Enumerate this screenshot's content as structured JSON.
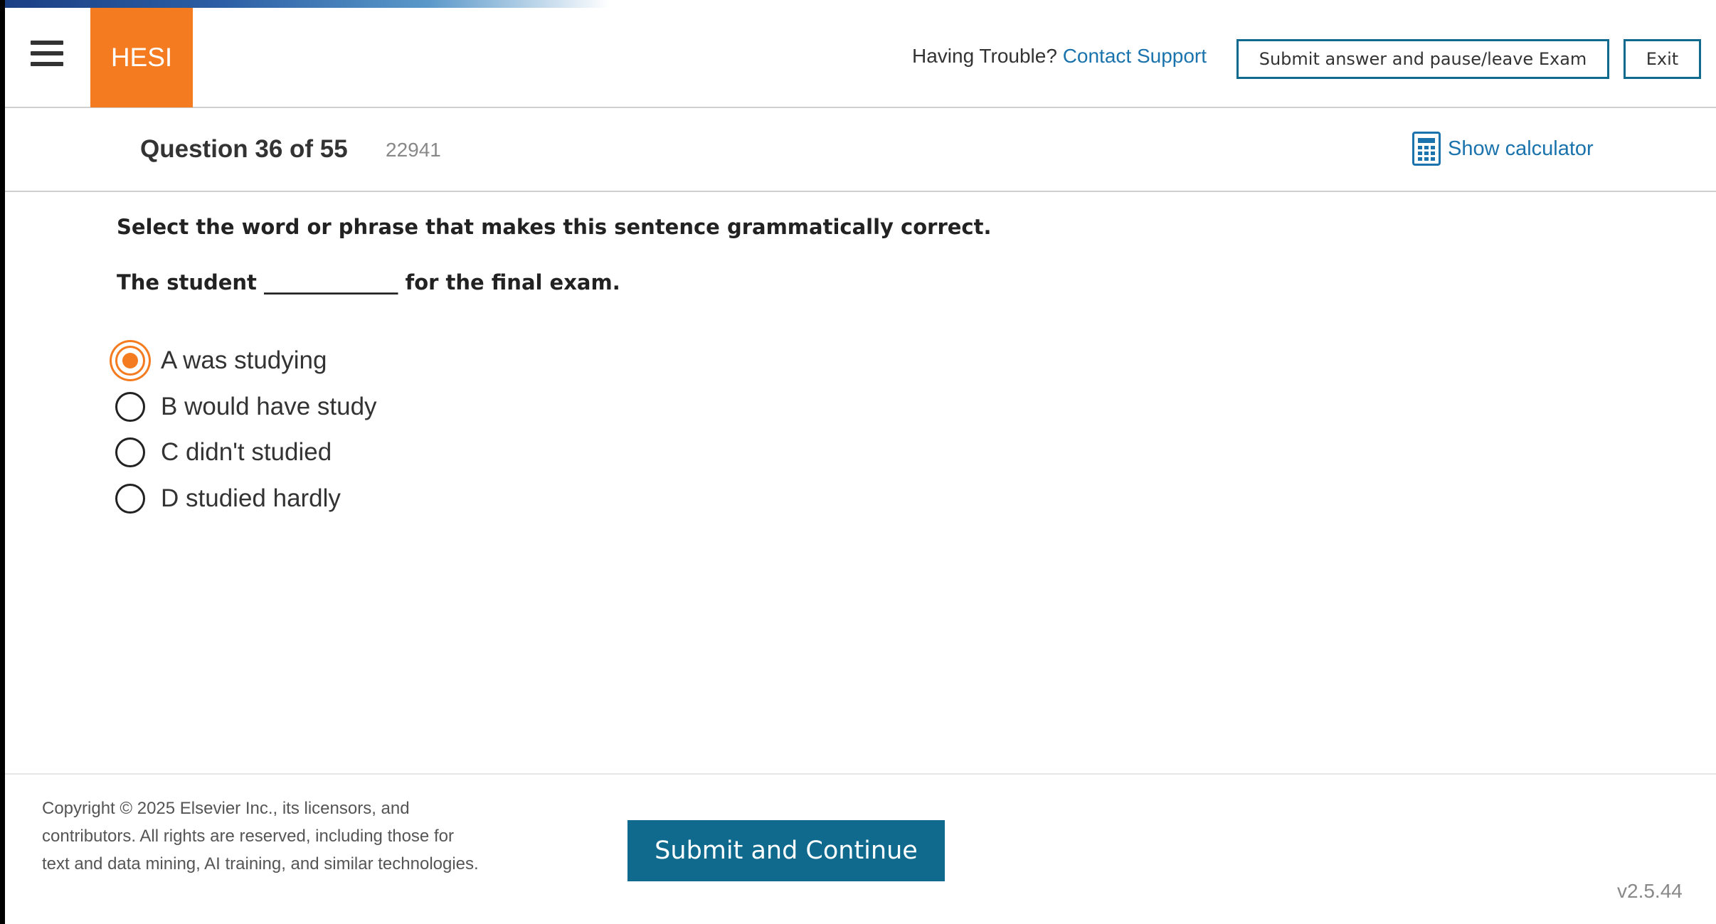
{
  "header": {
    "logo": "HESI",
    "trouble_text": "Having Trouble?",
    "contact_link": "Contact Support",
    "submit_pause_label": "Submit answer and pause/leave Exam",
    "exit_label": "Exit"
  },
  "question_bar": {
    "question_label": "Question 36 of 55",
    "question_id": "22941",
    "calculator_label": "Show calculator"
  },
  "question": {
    "instruction": "Select the word or phrase that makes this sentence grammatically correct.",
    "stem": "The student _____________ for the final exam.",
    "options": [
      {
        "letter": "A",
        "text": "was studying",
        "selected": true
      },
      {
        "letter": "B",
        "text": "would have study",
        "selected": false
      },
      {
        "letter": "C",
        "text": "didn't studied",
        "selected": false
      },
      {
        "letter": "D",
        "text": "studied hardly",
        "selected": false
      }
    ]
  },
  "footer": {
    "copyright": "Copyright © 2025 Elsevier Inc., its licensors, and contributors. All rights are reserved, including those for text and data mining, AI training, and similar technologies.",
    "submit_continue_label": "Submit and Continue",
    "version": "v2.5.44"
  },
  "colors": {
    "accent_orange": "#f47b20",
    "primary_teal": "#0f6a8e",
    "link_blue": "#1a73ad"
  },
  "icons": {
    "menu": "hamburger-menu-icon",
    "calculator": "calculator-icon",
    "radio": "radio-button-icon"
  }
}
